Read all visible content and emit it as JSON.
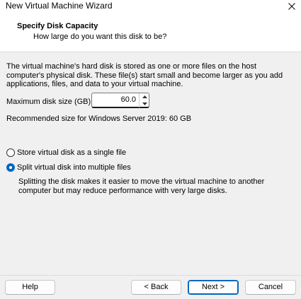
{
  "window": {
    "title": "New Virtual Machine Wizard",
    "close_icon": "close-icon"
  },
  "header": {
    "title": "Specify Disk Capacity",
    "subtitle": "How large do you want this disk to be?"
  },
  "content": {
    "description": "The virtual machine's hard disk is stored as one or more files on the host computer's physical disk. These file(s) start small and become larger as you add applications, files, and data to your virtual machine.",
    "max_size_label": "Maximum disk size (GB):",
    "max_size_value": "60.0",
    "recommended": "Recommended size for Windows Server 2019: 60 GB",
    "options": [
      {
        "label": "Store virtual disk as a single file",
        "selected": false
      },
      {
        "label": "Split virtual disk into multiple files",
        "selected": true
      }
    ],
    "split_description": "Splitting the disk makes it easier to move the virtual machine to another computer but may reduce performance with very large disks."
  },
  "footer": {
    "help": "Help",
    "back": "< Back",
    "next": "Next >",
    "cancel": "Cancel"
  },
  "colors": {
    "accent": "#0067c0",
    "dialog_bg": "#f0f0f0",
    "header_bg": "#ffffff"
  }
}
